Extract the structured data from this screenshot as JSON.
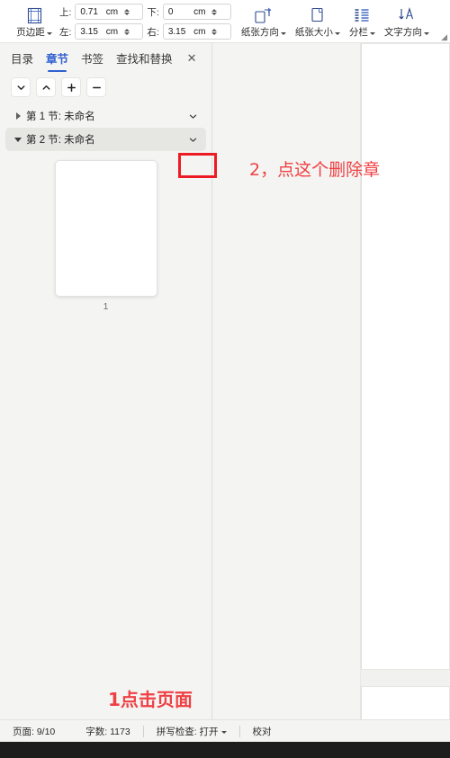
{
  "ribbon": {
    "margins": {
      "icon": "page-margins-icon",
      "label": "页边距",
      "fields": [
        {
          "name": "top",
          "label": "上:",
          "value": "0.71",
          "unit": "cm"
        },
        {
          "name": "bottom",
          "label": "下:",
          "value": "0",
          "unit": "cm"
        },
        {
          "name": "left",
          "label": "左:",
          "value": "3.15",
          "unit": "cm"
        },
        {
          "name": "right",
          "label": "右:",
          "value": "3.15",
          "unit": "cm"
        }
      ]
    },
    "buttons": [
      {
        "name": "page-orientation",
        "icon": "page-rotate-icon",
        "label": "纸张方向"
      },
      {
        "name": "paper-size",
        "icon": "page-size-icon",
        "label": "纸张大小"
      },
      {
        "name": "columns",
        "icon": "columns-icon",
        "label": "分栏"
      },
      {
        "name": "text-direction",
        "icon": "text-direction-icon",
        "label": "文字方向"
      }
    ],
    "expander": "◢"
  },
  "nav": {
    "tabs": [
      {
        "label": "目录",
        "active": false
      },
      {
        "label": "章节",
        "active": true
      },
      {
        "label": "书签",
        "active": false
      },
      {
        "label": "查找和替换",
        "active": false
      }
    ],
    "close_label": "✕",
    "tools": [
      {
        "name": "next-section-button",
        "icon": "chevron-down-icon"
      },
      {
        "name": "prev-section-button",
        "icon": "chevron-up-icon"
      },
      {
        "name": "add-section-button",
        "icon": "plus-icon"
      },
      {
        "name": "remove-section-button",
        "icon": "minus-icon"
      }
    ],
    "tree": [
      {
        "label": "第 1 节: 未命名",
        "expanded": false,
        "selected": false
      },
      {
        "label": "第 2 节: 未命名",
        "expanded": true,
        "selected": true
      }
    ],
    "thumbnail": {
      "page_number": "1"
    }
  },
  "annotations": [
    {
      "name": "annotation-step-2",
      "text": "2，点这个删除章"
    },
    {
      "name": "annotation-step-1",
      "text": "1点击页面"
    }
  ],
  "status": {
    "page": "页面: 9/10",
    "words": "字数: 1173",
    "spellcheck": "拼写检查: 打开",
    "proofread": "校对"
  },
  "colors": {
    "accent": "#2f5fd0",
    "annotation_red": "#ef4044",
    "highlight_box": "#ed1c24",
    "panel_bg": "#f4f4f2",
    "workspace_bg": "#f1f1ef",
    "selected_row": "#e6e6e3"
  }
}
